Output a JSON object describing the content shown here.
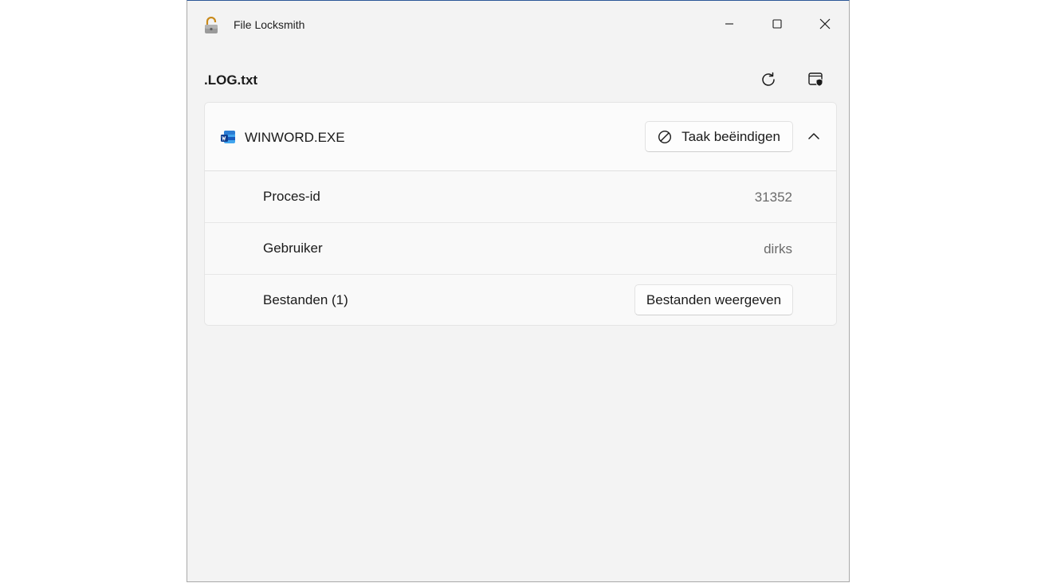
{
  "window": {
    "title": "File Locksmith"
  },
  "header": {
    "file_name": ".LOG.txt",
    "refresh_icon": "refresh-icon",
    "admin_icon": "restart-as-admin-icon"
  },
  "process": {
    "name": "WINWORD.EXE",
    "end_task_label": "Taak beëindigen",
    "rows": [
      {
        "label": "Proces-id",
        "value": "31352"
      },
      {
        "label": "Gebruiker",
        "value": "dirks"
      },
      {
        "label": "Bestanden (1)",
        "button": "Bestanden weergeven"
      }
    ]
  },
  "colors": {
    "accent": "#2b5797",
    "window_bg": "#f3f3f3",
    "card_bg": "#f9f9f9"
  }
}
